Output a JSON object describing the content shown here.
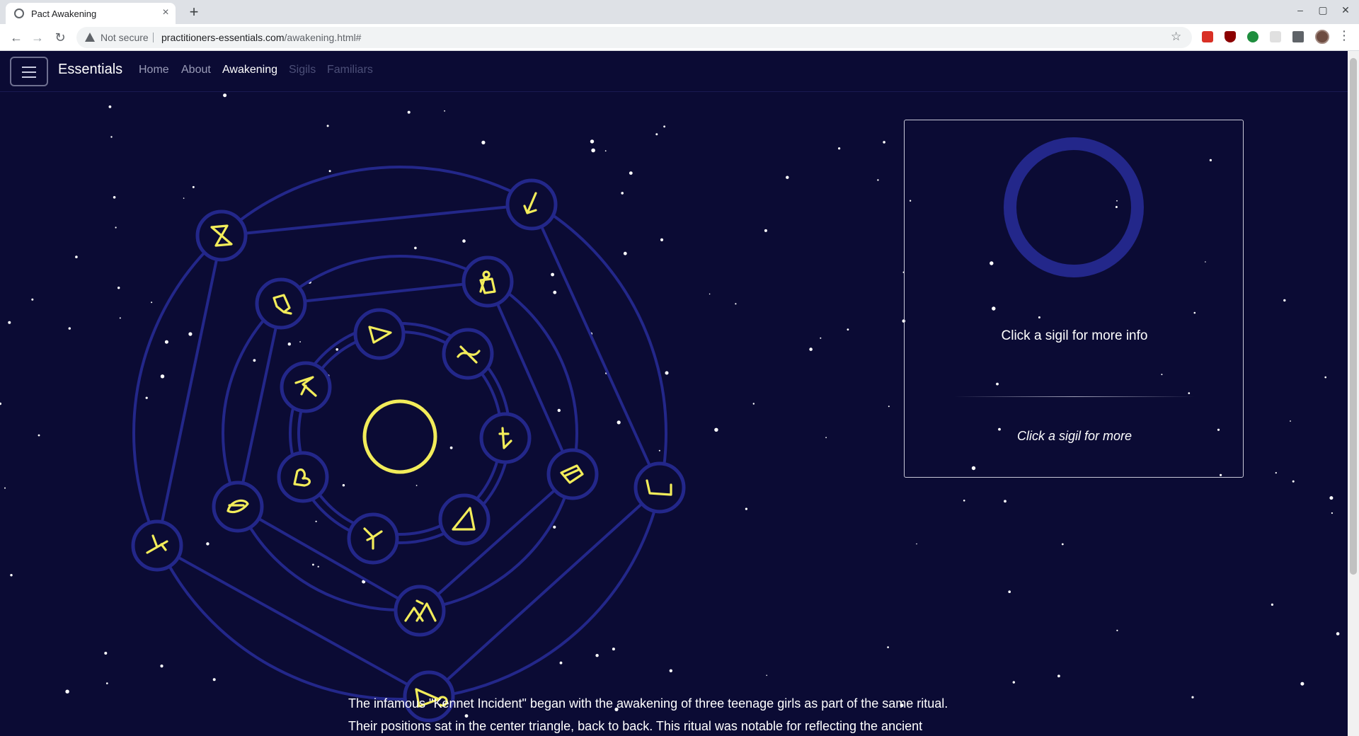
{
  "browser": {
    "tab_title": "Pact Awakening",
    "tab_close": "×",
    "new_tab": "+",
    "security_label": "Not secure",
    "url_domain": "practitioners-essentials.com",
    "url_path": "/awakening.html#",
    "window_controls": [
      "–",
      "▢",
      "✕"
    ]
  },
  "navbar": {
    "brand": "Essentials",
    "links": [
      {
        "label": "Home",
        "state": "normal"
      },
      {
        "label": "About",
        "state": "normal"
      },
      {
        "label": "Awakening",
        "state": "active"
      },
      {
        "label": "Sigils",
        "state": "disabled"
      },
      {
        "label": "Familiars",
        "state": "disabled"
      }
    ]
  },
  "colors": {
    "background": "#0b0b34",
    "ring": "#23278a",
    "sigil": "#f2ec5a",
    "nav_active": "#ffffff",
    "nav_normal": "#9a9cb8",
    "nav_disabled": "#4c4f78"
  },
  "diagram": {
    "center_icon": "circle-sigil-icon",
    "sigils": [
      "hourglass-sigil-icon",
      "arrow-sigil-icon",
      "kite-sigil-icon",
      "figure-sigil-icon",
      "triangle-sigil-icon",
      "wave-sigil-icon",
      "caret-sigil-icon",
      "down-arrow-sigil-icon",
      "heart-sigil-icon",
      "fork-sigil-icon",
      "delta-sigil-icon",
      "leaf-sigil-icon",
      "book-sigil-icon",
      "branch-sigil-icon",
      "bowl-sigil-icon",
      "mountain-sigil-icon",
      "fish-sigil-icon"
    ]
  },
  "info_panel": {
    "title": "Click a sigil for more info",
    "description": "Click a sigil for more"
  },
  "story": {
    "line1": "The infamous \"Kennet Incident\" began with the awakening of three teenage girls as part of the same ritual.",
    "line2": "Their positions sat in the center triangle, back to back. This ritual was notable for reflecting the ancient"
  }
}
